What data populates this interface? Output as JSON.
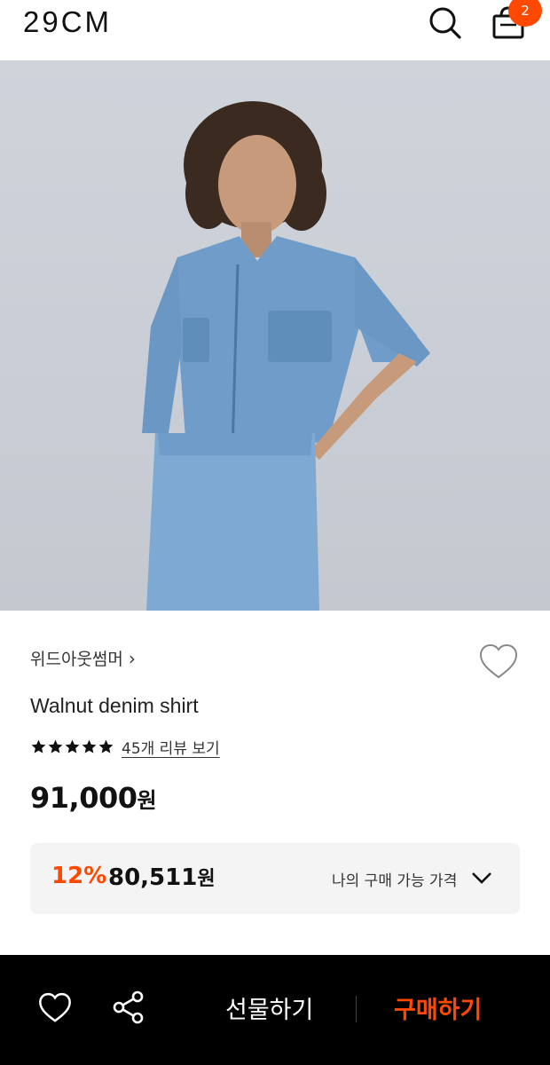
{
  "header": {
    "logo": "29CM",
    "cart_count": "2",
    "icons": [
      "search-icon",
      "shopping-bag-icon"
    ]
  },
  "product": {
    "brand": "위드아웃썸머",
    "brand_chevron": "›",
    "name": "Walnut denim shirt",
    "rating_stars": 5,
    "review_link": "45개 리뷰 보기",
    "price_number": "91,000",
    "price_unit": "원"
  },
  "discount": {
    "rate": "12%",
    "price_number": "80,511",
    "price_unit": "원",
    "label": "나의 구매 가능 가격"
  },
  "bottom_bar": {
    "gift_label": "선물하기",
    "buy_label": "구매하기",
    "icons": [
      "heart-icon",
      "share-icon"
    ]
  },
  "colors": {
    "accent": "#ff4800",
    "bar_bg": "#000000",
    "box_bg": "#f4f4f4"
  }
}
